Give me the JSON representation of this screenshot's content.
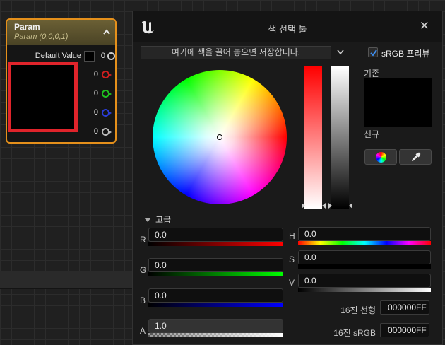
{
  "node": {
    "title": "Param",
    "subtitle": "Param (0,0,0,1)",
    "default_label": "Default Value",
    "default_value": "0",
    "pins": [
      {
        "value": "0",
        "color": "#cc1f1f"
      },
      {
        "value": "0",
        "color": "#1fbf1f"
      },
      {
        "value": "0",
        "color": "#2a3dd8"
      },
      {
        "value": "0",
        "color": "#bbbbbb"
      }
    ]
  },
  "picker": {
    "title": "색 선택 툴",
    "close_glyph": "✕",
    "drop_hint": "여기에 색을 끌어 놓으면 저장합니다.",
    "srgb_label": "sRGB 프리뷰",
    "srgb_checked": true,
    "old_label": "기존",
    "new_label": "신규",
    "tools": [
      "color-wheel-icon",
      "eyedropper-icon"
    ],
    "advanced_label": "고급",
    "channels": {
      "r": {
        "label": "R",
        "value": "0.0"
      },
      "g": {
        "label": "G",
        "value": "0.0"
      },
      "b": {
        "label": "B",
        "value": "0.0"
      },
      "a": {
        "label": "A",
        "value": "1.0"
      },
      "h": {
        "label": "H",
        "value": "0.0"
      },
      "s": {
        "label": "S",
        "value": "0.0"
      },
      "v": {
        "label": "V",
        "value": "0.0"
      }
    },
    "hex_linear_label": "16진 선형",
    "hex_linear_value": "000000FF",
    "hex_srgb_label": "16진 sRGB",
    "hex_srgb_value": "000000FF"
  }
}
